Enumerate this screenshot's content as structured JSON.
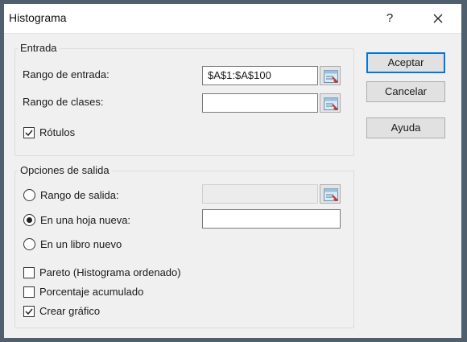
{
  "window": {
    "title": "Histograma",
    "help_label": "?",
    "close_icon": "close-icon"
  },
  "entrada": {
    "legend": "Entrada",
    "rango_entrada_label": "Rango de entrada:",
    "rango_entrada_value": "$A$1:$A$100",
    "rango_clases_label": "Rango de clases:",
    "rango_clases_value": "",
    "rotulos_label": "Rótulos",
    "rotulos_checked": true
  },
  "salida": {
    "legend": "Opciones de salida",
    "rango_salida_label": "Rango de salida:",
    "rango_salida_value": "",
    "hoja_nueva_label": "En una hoja nueva:",
    "hoja_nueva_value": "",
    "libro_nuevo_label": "En un libro nuevo",
    "selected_option": "hoja_nueva",
    "pareto_label": "Pareto (Histograma ordenado)",
    "pareto_checked": false,
    "porcentaje_label": "Porcentaje acumulado",
    "porcentaje_checked": false,
    "grafico_label": "Crear gráfico",
    "grafico_checked": true
  },
  "buttons": {
    "aceptar": "Aceptar",
    "cancelar": "Cancelar",
    "ayuda": "Ayuda"
  },
  "colors": {
    "accent": "#0078d7",
    "frame": "#4f5f6e",
    "client_bg": "#f0f0f0"
  }
}
